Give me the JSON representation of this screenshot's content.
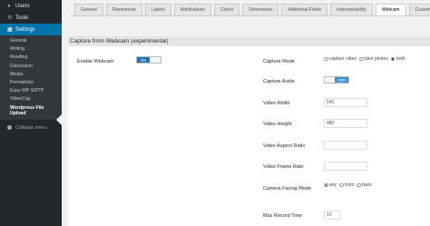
{
  "sidebar": {
    "top_items": [
      {
        "label": "Users",
        "icon": "users-icon"
      },
      {
        "label": "Tools",
        "icon": "wrench-icon"
      },
      {
        "label": "Settings",
        "icon": "settings-icon"
      }
    ],
    "sub_items": [
      "General",
      "Writing",
      "Reading",
      "Discussion",
      "Media",
      "Permalinks",
      "Easy WP SMTP",
      "VideoCap"
    ],
    "current_sub_item": [
      "Wordpress File",
      "Upload"
    ],
    "collapse_label": "Collapse menu"
  },
  "tabs": [
    "General",
    "Placements",
    "Labels",
    "Notifications",
    "Colors",
    "Dimensions",
    "Additional Fields",
    "Interoperability",
    "Webcam",
    "Custom CSS"
  ],
  "active_tab": "Webcam",
  "section_title": "Capture from Webcam (experimental)",
  "fields": {
    "enable_webcam": {
      "label": "Enable Webcam",
      "toggle": "ON"
    },
    "capture_mode": {
      "label": "Capture Mode",
      "options": [
        "capture video",
        "take photos",
        "both"
      ],
      "selected": "both"
    },
    "capture_audio": {
      "label": "Capture Audio",
      "toggle": "OFF"
    },
    "video_width": {
      "label": "Video Width",
      "value": "640"
    },
    "video_height": {
      "label": "Video Height",
      "value": "480"
    },
    "video_aspect_ratio": {
      "label": "Video Aspect Ratio",
      "value": ""
    },
    "video_frame_rate": {
      "label": "Video Frame Rate",
      "value": ""
    },
    "camera_facing_mode": {
      "label": "Camera Facing Mode",
      "options": [
        "any",
        "front",
        "back"
      ],
      "selected": "any"
    },
    "max_record_time": {
      "label": "Max Record Time",
      "value": "10"
    }
  },
  "colors": {
    "sidebar_bg": "#23282d",
    "submenu_bg": "#32373c",
    "accent": "#0073aa",
    "toggle_on": "#2271b1",
    "page_bg": "#f1f1f1"
  }
}
